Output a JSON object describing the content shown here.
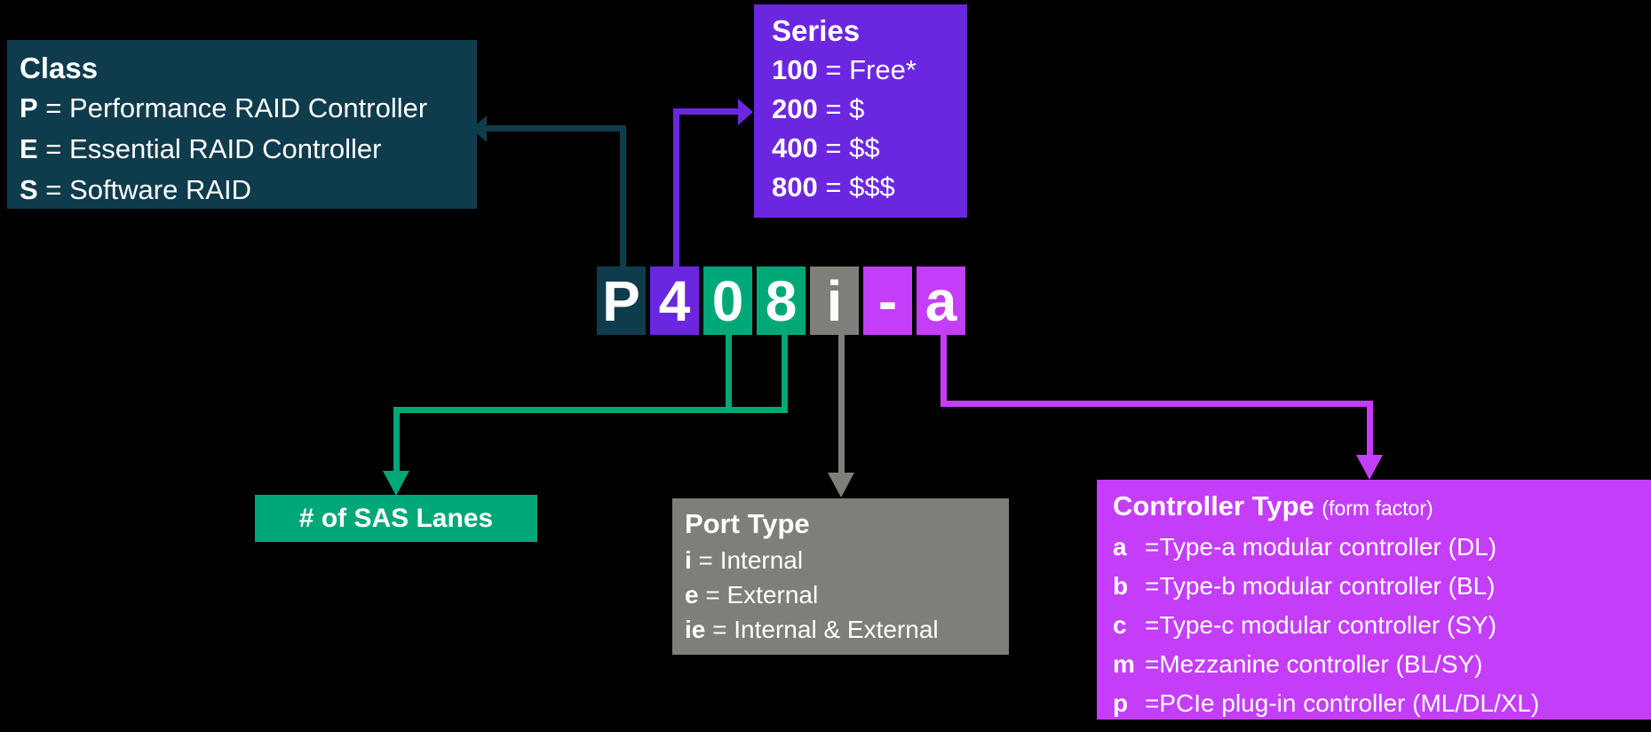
{
  "colors": {
    "background": "#000000",
    "class": "#0e3c4d",
    "series": "#6b27e0",
    "lanes": "#00a878",
    "port": "#807e78",
    "controller": "#c43efa",
    "text": "#ffffff"
  },
  "part_number": {
    "label": "P408i-a",
    "tiles": [
      {
        "char": "P",
        "group": "class"
      },
      {
        "char": "4",
        "group": "series"
      },
      {
        "char": "0",
        "group": "lanes"
      },
      {
        "char": "8",
        "group": "lanes"
      },
      {
        "char": "i",
        "group": "port"
      },
      {
        "char": "-",
        "group": "controller"
      },
      {
        "char": "a",
        "group": "controller"
      }
    ]
  },
  "class_box": {
    "title": "Class",
    "rows": [
      {
        "key": "P",
        "sep": " = ",
        "value": "Performance RAID Controller"
      },
      {
        "key": "E",
        "sep": " = ",
        "value": "Essential RAID Controller"
      },
      {
        "key": "S",
        "sep": " = ",
        "value": "Software RAID"
      }
    ]
  },
  "series_box": {
    "title": "Series",
    "rows": [
      {
        "key": "100",
        "sep": " = ",
        "value": "Free*"
      },
      {
        "key": "200",
        "sep": " = ",
        "value": "$"
      },
      {
        "key": "400",
        "sep": " = ",
        "value": "$$"
      },
      {
        "key": "800",
        "sep": " = ",
        "value": "$$$"
      }
    ]
  },
  "lanes_box": {
    "title": "# of SAS Lanes"
  },
  "port_box": {
    "title": "Port Type",
    "rows": [
      {
        "key": "i",
        "sep": " = ",
        "value": "Internal"
      },
      {
        "key": "e",
        "sep": " = ",
        "value": "External"
      },
      {
        "key": "ie",
        "sep": " = ",
        "value": "Internal & External"
      }
    ]
  },
  "controller_box": {
    "title": "Controller Type",
    "subtitle": "(form factor)",
    "rows": [
      {
        "key": "a",
        "sep": "= ",
        "value": "Type-a modular controller (DL)"
      },
      {
        "key": "b",
        "sep": "= ",
        "value": "Type-b modular controller (BL)"
      },
      {
        "key": "c",
        "sep": "= ",
        "value": "Type-c modular controller (SY)"
      },
      {
        "key": "m",
        "sep": "= ",
        "value": "Mezzanine controller (BL/SY)"
      },
      {
        "key": "p",
        "sep": "= ",
        "value": "PCIe plug-in controller (ML/DL/XL)"
      }
    ]
  },
  "connectors": [
    {
      "name": "class-connector",
      "color": "#0e3c4d",
      "from": "P tile",
      "to": "Class box",
      "arrow": "left"
    },
    {
      "name": "series-connector",
      "color": "#6b27e0",
      "from": "4 tile",
      "to": "Series box",
      "arrow": "right"
    },
    {
      "name": "lanes-connector",
      "color": "#00a878",
      "from": "0 and 8 tiles",
      "to": "# of SAS Lanes box",
      "arrow": "down"
    },
    {
      "name": "port-connector",
      "color": "#807e78",
      "from": "i tile",
      "to": "Port Type box",
      "arrow": "down"
    },
    {
      "name": "controller-connector",
      "color": "#c43efa",
      "from": "a tile",
      "to": "Controller Type box",
      "arrow": "down"
    }
  ]
}
